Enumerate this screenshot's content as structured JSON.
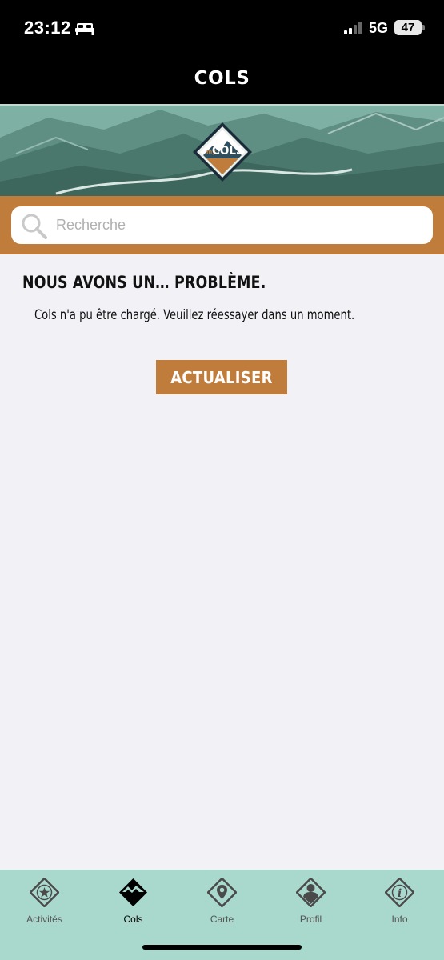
{
  "status_bar": {
    "time": "23:12",
    "network": "5G",
    "battery": "47",
    "icons": [
      "sleep-icon",
      "signal-icon",
      "battery-icon"
    ]
  },
  "header": {
    "title": "COLS"
  },
  "logo": {
    "small_text": "my",
    "big_text": "COLS"
  },
  "search": {
    "placeholder": "Recherche",
    "value": ""
  },
  "error": {
    "title": "NOUS AVONS UN… PROBLÈME.",
    "message": "Cols n'a pu être chargé. Veuillez réessayer dans un moment.",
    "button_label": "ACTUALISER"
  },
  "tabs": [
    {
      "label": "Activités",
      "icon": "star-diamond-icon",
      "active": false
    },
    {
      "label": "Cols",
      "icon": "mountain-diamond-icon",
      "active": true
    },
    {
      "label": "Carte",
      "icon": "map-pin-diamond-icon",
      "active": false
    },
    {
      "label": "Profil",
      "icon": "person-diamond-icon",
      "active": false
    },
    {
      "label": "Info",
      "icon": "info-diamond-icon",
      "active": false
    }
  ],
  "colors": {
    "accent": "#c07c3a",
    "tabbar": "#a9d8cd",
    "background": "#f2f1f6",
    "header": "#000000"
  }
}
